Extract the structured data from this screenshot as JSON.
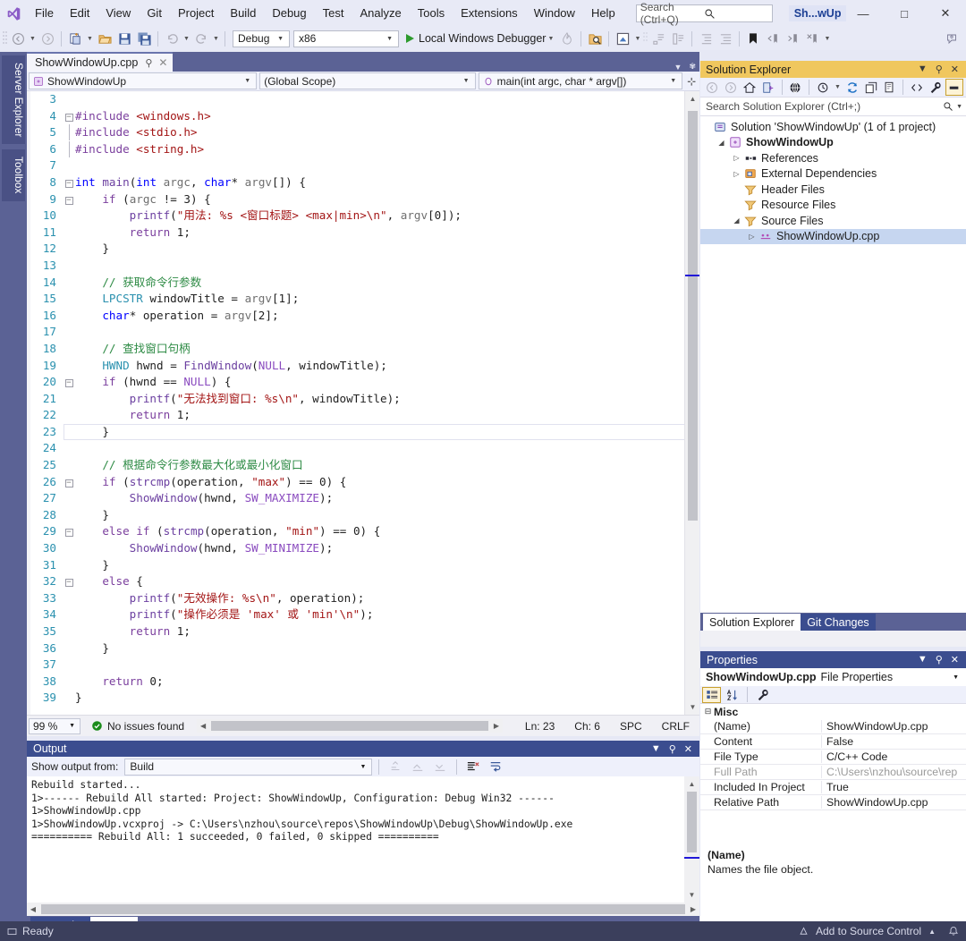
{
  "app": {
    "window_title": "Sh...wUp",
    "logo_icon": "visual-studio-logo"
  },
  "menu": {
    "items": [
      {
        "label": "File"
      },
      {
        "label": "Edit"
      },
      {
        "label": "View"
      },
      {
        "label": "Git"
      },
      {
        "label": "Project"
      },
      {
        "label": "Build"
      },
      {
        "label": "Debug"
      },
      {
        "label": "Test"
      },
      {
        "label": "Analyze"
      },
      {
        "label": "Tools"
      },
      {
        "label": "Extensions"
      },
      {
        "label": "Window"
      },
      {
        "label": "Help"
      }
    ],
    "search_placeholder": "Search (Ctrl+Q)",
    "search_icon": "magnifier-icon"
  },
  "window_buttons": {
    "minimize": "—",
    "maximize": "□",
    "close": "✕"
  },
  "toolbar": {
    "config_value": "Debug",
    "platform_value": "x86",
    "run_label": "Local Windows Debugger",
    "icons": [
      "navigate-back-icon",
      "navigate-forward-icon",
      "new-project-icon",
      "open-file-icon",
      "save-icon",
      "save-all-icon",
      "undo-icon",
      "redo-icon",
      "hot-reload-icon",
      "find-in-files-icon",
      "window-layout-icon",
      "comment-icon",
      "uncomment-icon",
      "decrease-indent-icon",
      "increase-indent-icon",
      "bookmark-icon",
      "prev-bookmark-icon",
      "next-bookmark-icon",
      "clear-bookmarks-icon",
      "feedback-icon"
    ]
  },
  "left_tabs": {
    "items": [
      {
        "label": "Server Explorer"
      },
      {
        "label": "Toolbox"
      }
    ]
  },
  "editor": {
    "tab_label": "ShowWindowUp.cpp",
    "pin_icon": "pin-icon",
    "close_icon": "close-icon",
    "nav": {
      "project": "ShowWindowUp",
      "scope": "(Global Scope)",
      "member": "main(int argc, char * argv[])",
      "split_icon": "split-editor-icon"
    },
    "lines": [
      {
        "n": 3,
        "fold": "",
        "tokens": []
      },
      {
        "n": 4,
        "fold": "−",
        "tokens": [
          {
            "t": "#include ",
            "c": "pre"
          },
          {
            "t": "<windows.h>",
            "c": "inc"
          }
        ]
      },
      {
        "n": 5,
        "fold": "",
        "indentbar": 1,
        "tokens": [
          {
            "t": "#include ",
            "c": "pre"
          },
          {
            "t": "<stdio.h>",
            "c": "inc"
          }
        ]
      },
      {
        "n": 6,
        "fold": "",
        "indentbar": 1,
        "tokens": [
          {
            "t": "#include ",
            "c": "pre"
          },
          {
            "t": "<string.h>",
            "c": "inc"
          }
        ]
      },
      {
        "n": 7,
        "fold": "",
        "tokens": []
      },
      {
        "n": 8,
        "fold": "−",
        "tokens": [
          {
            "t": "int ",
            "c": "kw"
          },
          {
            "t": "main",
            "c": "fn"
          },
          {
            "t": "(",
            "c": ""
          },
          {
            "t": "int ",
            "c": "kw"
          },
          {
            "t": "argc",
            "c": "id"
          },
          {
            "t": ", ",
            "c": ""
          },
          {
            "t": "char",
            "c": "kw"
          },
          {
            "t": "* ",
            "c": ""
          },
          {
            "t": "argv",
            "c": "id"
          },
          {
            "t": "[]) {",
            "c": ""
          }
        ]
      },
      {
        "n": 9,
        "fold": "−",
        "tokens": [
          {
            "t": "    ",
            "c": ""
          },
          {
            "t": "if ",
            "c": "kw2"
          },
          {
            "t": "(",
            "c": ""
          },
          {
            "t": "argc ",
            "c": "id"
          },
          {
            "t": "!= ",
            "c": ""
          },
          {
            "t": "3",
            "c": "num"
          },
          {
            "t": ") {",
            "c": ""
          }
        ]
      },
      {
        "n": 10,
        "fold": "",
        "tokens": [
          {
            "t": "        ",
            "c": ""
          },
          {
            "t": "printf",
            "c": "fn"
          },
          {
            "t": "(",
            "c": ""
          },
          {
            "t": "\"用法: %s <窗口标题> <max|min>\\n\"",
            "c": "str"
          },
          {
            "t": ", ",
            "c": ""
          },
          {
            "t": "argv",
            "c": "id"
          },
          {
            "t": "[",
            "c": ""
          },
          {
            "t": "0",
            "c": "num"
          },
          {
            "t": "]);",
            "c": ""
          }
        ]
      },
      {
        "n": 11,
        "fold": "",
        "tokens": [
          {
            "t": "        ",
            "c": ""
          },
          {
            "t": "return ",
            "c": "kw2"
          },
          {
            "t": "1;",
            "c": ""
          }
        ]
      },
      {
        "n": 12,
        "fold": "",
        "tokens": [
          {
            "t": "    }",
            "c": ""
          }
        ]
      },
      {
        "n": 13,
        "fold": "",
        "tokens": []
      },
      {
        "n": 14,
        "fold": "",
        "tokens": [
          {
            "t": "    ",
            "c": ""
          },
          {
            "t": "// 获取命令行参数",
            "c": "cmt"
          }
        ]
      },
      {
        "n": 15,
        "fold": "",
        "tokens": [
          {
            "t": "    ",
            "c": ""
          },
          {
            "t": "LPCSTR ",
            "c": "typ"
          },
          {
            "t": "windowTitle ",
            "c": ""
          },
          {
            "t": "= ",
            "c": ""
          },
          {
            "t": "argv",
            "c": "id"
          },
          {
            "t": "[",
            "c": ""
          },
          {
            "t": "1",
            "c": "num"
          },
          {
            "t": "];",
            "c": ""
          }
        ]
      },
      {
        "n": 16,
        "fold": "",
        "tokens": [
          {
            "t": "    ",
            "c": ""
          },
          {
            "t": "char",
            "c": "kw"
          },
          {
            "t": "* operation ",
            "c": ""
          },
          {
            "t": "= ",
            "c": ""
          },
          {
            "t": "argv",
            "c": "id"
          },
          {
            "t": "[",
            "c": ""
          },
          {
            "t": "2",
            "c": "num"
          },
          {
            "t": "];",
            "c": ""
          }
        ]
      },
      {
        "n": 17,
        "fold": "",
        "tokens": []
      },
      {
        "n": 18,
        "fold": "",
        "tokens": [
          {
            "t": "    ",
            "c": ""
          },
          {
            "t": "// 查找窗口句柄",
            "c": "cmt"
          }
        ]
      },
      {
        "n": 19,
        "fold": "",
        "tokens": [
          {
            "t": "    ",
            "c": ""
          },
          {
            "t": "HWND ",
            "c": "typ"
          },
          {
            "t": "hwnd ",
            "c": ""
          },
          {
            "t": "= ",
            "c": ""
          },
          {
            "t": "FindWindow",
            "c": "fn"
          },
          {
            "t": "(",
            "c": ""
          },
          {
            "t": "NULL",
            "c": "mac"
          },
          {
            "t": ", windowTitle);",
            "c": ""
          }
        ]
      },
      {
        "n": 20,
        "fold": "−",
        "tokens": [
          {
            "t": "    ",
            "c": ""
          },
          {
            "t": "if ",
            "c": "kw2"
          },
          {
            "t": "(hwnd == ",
            "c": ""
          },
          {
            "t": "NULL",
            "c": "mac"
          },
          {
            "t": ") {",
            "c": ""
          }
        ]
      },
      {
        "n": 21,
        "fold": "",
        "tokens": [
          {
            "t": "        ",
            "c": ""
          },
          {
            "t": "printf",
            "c": "fn"
          },
          {
            "t": "(",
            "c": ""
          },
          {
            "t": "\"无法找到窗口: %s\\n\"",
            "c": "str"
          },
          {
            "t": ", windowTitle);",
            "c": ""
          }
        ]
      },
      {
        "n": 22,
        "fold": "",
        "tokens": [
          {
            "t": "        ",
            "c": ""
          },
          {
            "t": "return ",
            "c": "kw2"
          },
          {
            "t": "1;",
            "c": ""
          }
        ]
      },
      {
        "n": 23,
        "fold": "",
        "current": true,
        "tokens": [
          {
            "t": "    }",
            "c": ""
          }
        ]
      },
      {
        "n": 24,
        "fold": "",
        "tokens": []
      },
      {
        "n": 25,
        "fold": "",
        "tokens": [
          {
            "t": "    ",
            "c": ""
          },
          {
            "t": "// 根据命令行参数最大化或最小化窗口",
            "c": "cmt"
          }
        ]
      },
      {
        "n": 26,
        "fold": "−",
        "tokens": [
          {
            "t": "    ",
            "c": ""
          },
          {
            "t": "if ",
            "c": "kw2"
          },
          {
            "t": "(",
            "c": ""
          },
          {
            "t": "strcmp",
            "c": "fn"
          },
          {
            "t": "(operation, ",
            "c": ""
          },
          {
            "t": "\"max\"",
            "c": "str"
          },
          {
            "t": ") == ",
            "c": ""
          },
          {
            "t": "0",
            "c": "num"
          },
          {
            "t": ") {",
            "c": ""
          }
        ]
      },
      {
        "n": 27,
        "fold": "",
        "tokens": [
          {
            "t": "        ",
            "c": ""
          },
          {
            "t": "ShowWindow",
            "c": "fn"
          },
          {
            "t": "(hwnd, ",
            "c": ""
          },
          {
            "t": "SW_MAXIMIZE",
            "c": "mac"
          },
          {
            "t": ");",
            "c": ""
          }
        ]
      },
      {
        "n": 28,
        "fold": "",
        "tokens": [
          {
            "t": "    }",
            "c": ""
          }
        ]
      },
      {
        "n": 29,
        "fold": "−",
        "tokens": [
          {
            "t": "    ",
            "c": ""
          },
          {
            "t": "else if ",
            "c": "kw2"
          },
          {
            "t": "(",
            "c": ""
          },
          {
            "t": "strcmp",
            "c": "fn"
          },
          {
            "t": "(operation, ",
            "c": ""
          },
          {
            "t": "\"min\"",
            "c": "str"
          },
          {
            "t": ") == ",
            "c": ""
          },
          {
            "t": "0",
            "c": "num"
          },
          {
            "t": ") {",
            "c": ""
          }
        ]
      },
      {
        "n": 30,
        "fold": "",
        "tokens": [
          {
            "t": "        ",
            "c": ""
          },
          {
            "t": "ShowWindow",
            "c": "fn"
          },
          {
            "t": "(hwnd, ",
            "c": ""
          },
          {
            "t": "SW_MINIMIZE",
            "c": "mac"
          },
          {
            "t": ");",
            "c": ""
          }
        ]
      },
      {
        "n": 31,
        "fold": "",
        "tokens": [
          {
            "t": "    }",
            "c": ""
          }
        ]
      },
      {
        "n": 32,
        "fold": "−",
        "tokens": [
          {
            "t": "    ",
            "c": ""
          },
          {
            "t": "else ",
            "c": "kw2"
          },
          {
            "t": "{",
            "c": ""
          }
        ]
      },
      {
        "n": 33,
        "fold": "",
        "tokens": [
          {
            "t": "        ",
            "c": ""
          },
          {
            "t": "printf",
            "c": "fn"
          },
          {
            "t": "(",
            "c": ""
          },
          {
            "t": "\"无效操作: %s\\n\"",
            "c": "str"
          },
          {
            "t": ", operation);",
            "c": ""
          }
        ]
      },
      {
        "n": 34,
        "fold": "",
        "tokens": [
          {
            "t": "        ",
            "c": ""
          },
          {
            "t": "printf",
            "c": "fn"
          },
          {
            "t": "(",
            "c": ""
          },
          {
            "t": "\"操作必须是 'max' 或 'min'\\n\"",
            "c": "str"
          },
          {
            "t": ");",
            "c": ""
          }
        ]
      },
      {
        "n": 35,
        "fold": "",
        "tokens": [
          {
            "t": "        ",
            "c": ""
          },
          {
            "t": "return ",
            "c": "kw2"
          },
          {
            "t": "1;",
            "c": ""
          }
        ]
      },
      {
        "n": 36,
        "fold": "",
        "tokens": [
          {
            "t": "    }",
            "c": ""
          }
        ]
      },
      {
        "n": 37,
        "fold": "",
        "tokens": []
      },
      {
        "n": 38,
        "fold": "",
        "tokens": [
          {
            "t": "    ",
            "c": ""
          },
          {
            "t": "return ",
            "c": "kw2"
          },
          {
            "t": "0;",
            "c": ""
          }
        ]
      },
      {
        "n": 39,
        "fold": "",
        "tokens": [
          {
            "t": "}",
            "c": ""
          }
        ]
      }
    ]
  },
  "editor_status": {
    "zoom": "99 %",
    "issues": "No issues found",
    "issues_icon": "check-circle-icon",
    "line": "Ln: 23",
    "col": "Ch: 6",
    "spaces": "SPC",
    "eol": "CRLF"
  },
  "output": {
    "title": "Output",
    "show_from_label": "Show output from:",
    "source": "Build",
    "toolbar_icons": [
      "find-message-icon",
      "go-to-previous-icon",
      "go-to-next-icon",
      "clear-all-icon",
      "word-wrap-icon"
    ],
    "text": "Rebuild started...\n1>------ Rebuild All started: Project: ShowWindowUp, Configuration: Debug Win32 ------\n1>ShowWindowUp.cpp\n1>ShowWindowUp.vcxproj -> C:\\Users\\nzhou\\source\\repos\\ShowWindowUp\\Debug\\ShowWindowUp.exe\n========== Rebuild All: 1 succeeded, 0 failed, 0 skipped ==========",
    "tabs": [
      {
        "label": "Error List",
        "active": false
      },
      {
        "label": "Output",
        "active": true
      }
    ]
  },
  "solution_explorer": {
    "title": "Solution Explorer",
    "search_placeholder": "Search Solution Explorer (Ctrl+;)",
    "toolbar_icons": [
      "back-arrow-icon",
      "forward-arrow-icon",
      "home-icon",
      "sync-with-active-doc-icon",
      "global-scope-icon",
      "pending-changes-icon",
      "refresh-icon",
      "collapse-all-icon",
      "show-all-files-icon",
      "view-code-icon",
      "properties-wrench-icon",
      "preview-selected-icon"
    ],
    "tree": [
      {
        "indent": 0,
        "exp": "",
        "icon": "solution-icon",
        "label": "Solution 'ShowWindowUp' (1 of 1 project)",
        "bold": false
      },
      {
        "indent": 1,
        "exp": "◢",
        "icon": "cpp-project-icon",
        "label": "ShowWindowUp",
        "bold": true
      },
      {
        "indent": 2,
        "exp": "▷",
        "icon": "references-icon",
        "label": "References",
        "bold": false
      },
      {
        "indent": 2,
        "exp": "▷",
        "icon": "external-deps-icon",
        "label": "External Dependencies",
        "bold": false
      },
      {
        "indent": 2,
        "exp": "",
        "icon": "folder-filter-icon",
        "label": "Header Files",
        "bold": false
      },
      {
        "indent": 2,
        "exp": "",
        "icon": "folder-filter-icon",
        "label": "Resource Files",
        "bold": false
      },
      {
        "indent": 2,
        "exp": "◢",
        "icon": "folder-filter-icon",
        "label": "Source Files",
        "bold": false
      },
      {
        "indent": 3,
        "exp": "▷",
        "icon": "cpp-file-icon",
        "label": "ShowWindowUp.cpp",
        "bold": false,
        "selected": true
      }
    ],
    "tabs": [
      {
        "label": "Solution Explorer",
        "active": true
      },
      {
        "label": "Git Changes",
        "active": false
      }
    ]
  },
  "properties": {
    "title": "Properties",
    "object_name": "ShowWindowUp.cpp",
    "object_kind": "File Properties",
    "toolbar_icons": [
      "categorized-icon",
      "alphabetical-icon",
      "property-pages-wrench-icon"
    ],
    "category": "Misc",
    "rows": [
      {
        "key": "(Name)",
        "value": "ShowWindowUp.cpp",
        "dim": false
      },
      {
        "key": "Content",
        "value": "False",
        "dim": false
      },
      {
        "key": "File Type",
        "value": "C/C++ Code",
        "dim": false
      },
      {
        "key": "Full Path",
        "value": "C:\\Users\\nzhou\\source\\rep",
        "dim": true
      },
      {
        "key": "Included In Project",
        "value": "True",
        "dim": false
      },
      {
        "key": "Relative Path",
        "value": "ShowWindowUp.cpp",
        "dim": false
      }
    ],
    "desc_title": "(Name)",
    "desc_text": "Names the file object."
  },
  "status_bar": {
    "ready": "Ready",
    "source_control": "Add to Source Control",
    "ready_icon": "ready-icon",
    "notify_icon": "bell-icon"
  },
  "colors": {
    "accent_purple": "#5b6295",
    "title_bg": "#e8eaf6",
    "se_header": "#f0c75e",
    "pane_header": "#3b4d8f",
    "selection": "#c6d6f0",
    "comment_green": "#2e8b45",
    "string_red": "#a31515",
    "keyword_blue": "#0000ff",
    "macro_purple": "#8a4bbf",
    "type_teal": "#2b91af"
  }
}
